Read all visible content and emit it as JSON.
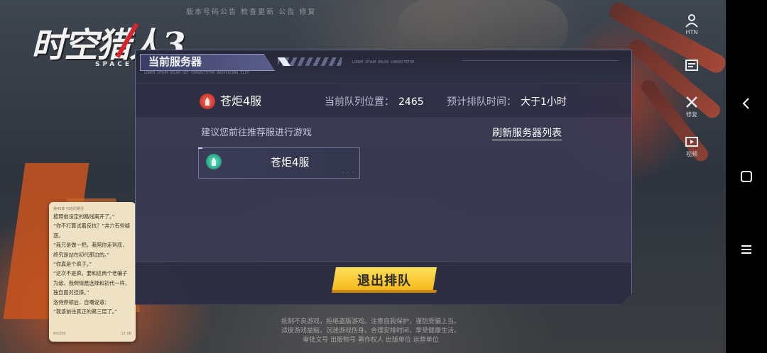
{
  "game": {
    "logo_title": "时空猎人3",
    "logo_sub": "SPACE",
    "header_strip": "版本号码公告  检查更新  公告  修复",
    "footer_lines": [
      "抵制不良游戏，拒绝盗版游戏。注意自我保护，谨防受骗上当。",
      "适度游戏益脑，沉迷游戏伤身。合理安排时间，享受健康生活。",
      "审批文号  出版物号  著作权人  出版单位  运营单位"
    ],
    "side_icons": [
      {
        "icon": "user-icon",
        "label": "HTN"
      },
      {
        "icon": "notice-icon",
        "label": ""
      },
      {
        "icon": "tools-icon",
        "label": "修复"
      },
      {
        "icon": "video-icon",
        "label": "视频"
      }
    ]
  },
  "dialog": {
    "title": "当前服务器",
    "meta_left": "LOREM IPSUM DOLOR SIT\nCONSECTETUR ADIPISCING ELIT",
    "meta_right": "LOREM IPSUM DOLOR\nCONSECTETUR",
    "current_server": "苍炬4服",
    "queue_label": "当前队列位置：",
    "queue_position": "2465",
    "wait_label": "预计排队时间：",
    "wait_time": "大于1小时",
    "suggest_text": "建议您前往推荐服进行游戏",
    "refresh_label": "刷新服务器列表",
    "recommended_server": "苍炬4服",
    "exit_label": "退出排队"
  },
  "book": {
    "header": "第45章  归途的路径",
    "paragraphs": [
      "按照他设定的路线离开了。”",
      "“你不打算试着反抗？”井六有些疑惑。",
      "“我只是做一把，我陪你走到底，终究是站在初代那边的。”",
      "“你真是个疯子。”",
      "“这次不是疯，要和这两个老骗子为敌，我倒情愿选择和初代一样，独自面对挂搽。”",
      "洛侍停顿后，自嘲说道：",
      "“我该前往真正的第三层了。”"
    ],
    "footer_left": "64/200",
    "footer_right": "17:08"
  },
  "colors": {
    "accent_yellow": "#f3b516",
    "dialog_bg": "#3a3a52",
    "server_red": "#d83a2c",
    "server_green": "#1fb48e"
  }
}
